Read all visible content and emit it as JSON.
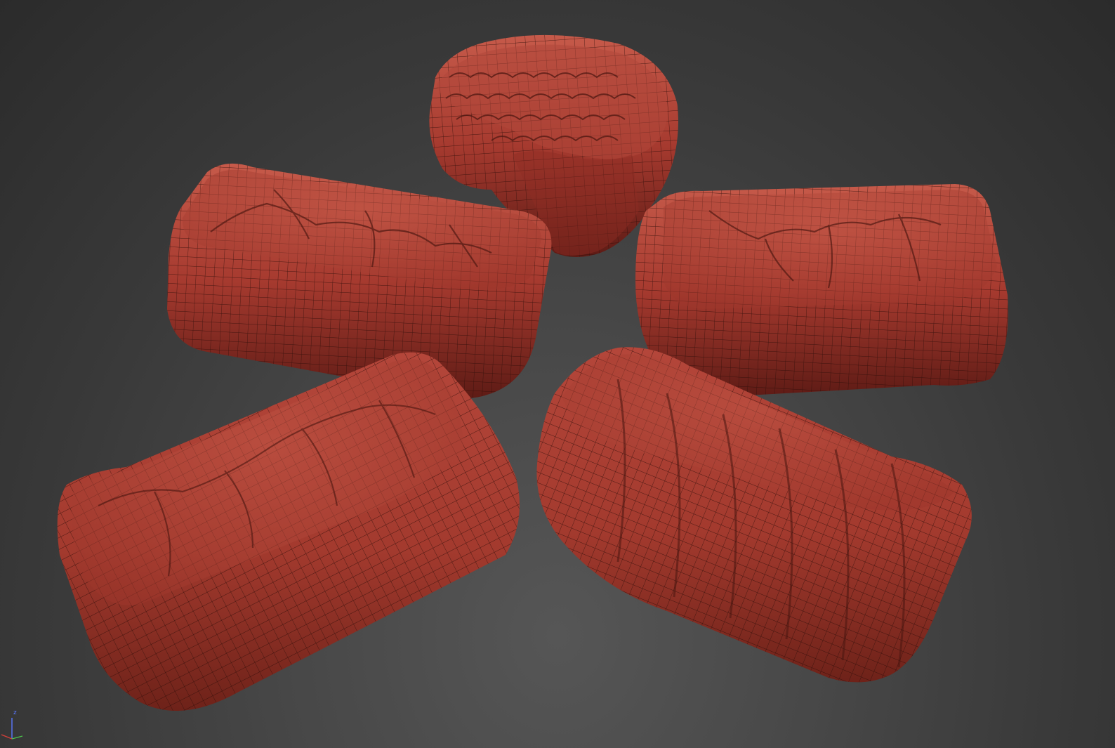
{
  "viewport": {
    "background_top": "#2b2b2b",
    "background_bottom": "#575757"
  },
  "mesh": {
    "base_color": "#a53a2e",
    "shadow_color": "#5d1c16",
    "highlight_color": "#d26553",
    "wire_color": "#2a0c08"
  },
  "models": [
    {
      "name": "round-candy",
      "style": "scallop"
    },
    {
      "name": "left-rect-candy",
      "style": "ridges"
    },
    {
      "name": "right-rect-candy",
      "style": "ridges"
    },
    {
      "name": "bottom-left-candy",
      "style": "folds"
    },
    {
      "name": "wrapped-candy",
      "style": "bands"
    }
  ],
  "gizmo": {
    "z_label": "z",
    "x_color": "#d8403a",
    "y_color": "#4cc24c",
    "z_color": "#5a78ff"
  }
}
